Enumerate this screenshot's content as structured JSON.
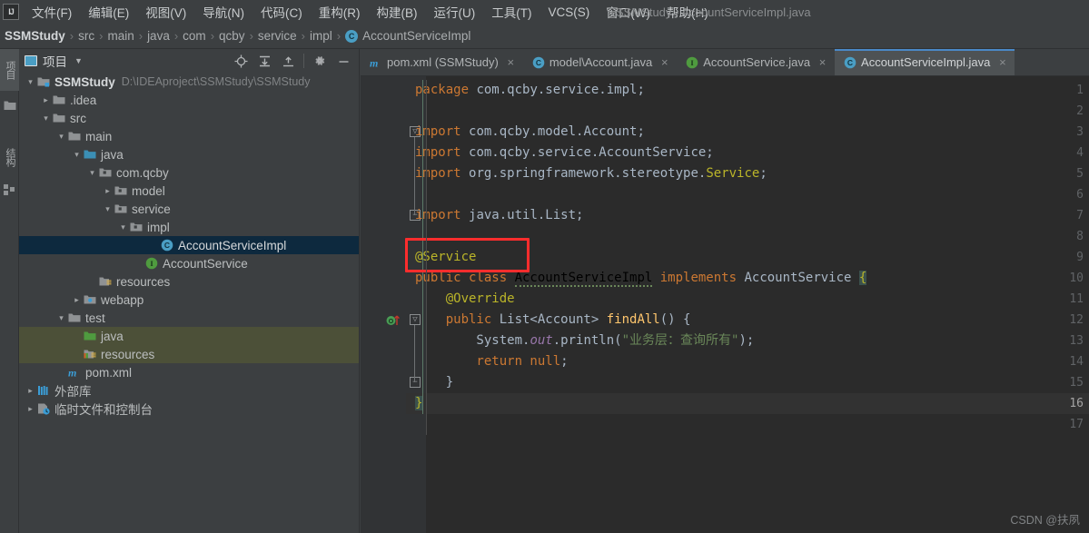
{
  "window": {
    "title": "SSMStudy - AccountServiceImpl.java",
    "logo": "IJ"
  },
  "menubar": {
    "items": [
      {
        "label": "文件(F)",
        "name": "menu-file"
      },
      {
        "label": "编辑(E)",
        "name": "menu-edit"
      },
      {
        "label": "视图(V)",
        "name": "menu-view"
      },
      {
        "label": "导航(N)",
        "name": "menu-navigate"
      },
      {
        "label": "代码(C)",
        "name": "menu-code"
      },
      {
        "label": "重构(R)",
        "name": "menu-refactor"
      },
      {
        "label": "构建(B)",
        "name": "menu-build"
      },
      {
        "label": "运行(U)",
        "name": "menu-run"
      },
      {
        "label": "工具(T)",
        "name": "menu-tools"
      },
      {
        "label": "VCS(S)",
        "name": "menu-vcs"
      },
      {
        "label": "窗口(W)",
        "name": "menu-window"
      },
      {
        "label": "帮助(H)",
        "name": "menu-help"
      }
    ]
  },
  "breadcrumb": {
    "separator": "›",
    "items": [
      "SSMStudy",
      "src",
      "main",
      "java",
      "com",
      "qcby",
      "service",
      "impl"
    ],
    "leaf": "AccountServiceImpl",
    "leaf_icon_letter": "C"
  },
  "toolstrip": {
    "buttons": [
      {
        "label": "项目",
        "name": "tool-button-project",
        "type": "vertical-text"
      },
      {
        "label": "",
        "name": "tool-button-folder",
        "type": "icon"
      },
      {
        "label": "结构",
        "name": "tool-button-structure",
        "type": "vertical-text"
      },
      {
        "label": "",
        "name": "tool-button-bookmarks",
        "type": "icon"
      }
    ]
  },
  "project_panel": {
    "title": "项目",
    "tools": [
      {
        "name": "locate-icon",
        "title": "Select Opened File"
      },
      {
        "name": "expand-all-icon",
        "title": "Expand All"
      },
      {
        "name": "collapse-all-icon",
        "title": "Collapse All"
      },
      {
        "name": "gear-icon",
        "title": "Settings"
      },
      {
        "name": "minimize-icon",
        "title": "Hide"
      }
    ],
    "tree": [
      {
        "label": "SSMStudy",
        "path": "D:\\IDEAproject\\SSMStudy\\SSMStudy",
        "indent": 0,
        "arrow": "down",
        "icon": "module-folder",
        "bold": true,
        "state": "normal"
      },
      {
        "label": ".idea",
        "path": "",
        "indent": 1,
        "arrow": "right",
        "icon": "folder",
        "bold": false,
        "state": "normal"
      },
      {
        "label": "src",
        "path": "",
        "indent": 1,
        "arrow": "down",
        "icon": "folder",
        "bold": false,
        "state": "normal"
      },
      {
        "label": "main",
        "path": "",
        "indent": 2,
        "arrow": "down",
        "icon": "folder",
        "bold": false,
        "state": "normal"
      },
      {
        "label": "java",
        "path": "",
        "indent": 3,
        "arrow": "down",
        "icon": "source-folder",
        "bold": false,
        "state": "normal"
      },
      {
        "label": "com.qcby",
        "path": "",
        "indent": 4,
        "arrow": "down",
        "icon": "package",
        "bold": false,
        "state": "normal"
      },
      {
        "label": "model",
        "path": "",
        "indent": 5,
        "arrow": "right",
        "icon": "package",
        "bold": false,
        "state": "normal"
      },
      {
        "label": "service",
        "path": "",
        "indent": 5,
        "arrow": "down",
        "icon": "package",
        "bold": false,
        "state": "normal"
      },
      {
        "label": "impl",
        "path": "",
        "indent": 6,
        "arrow": "down",
        "icon": "package",
        "bold": false,
        "state": "normal"
      },
      {
        "label": "AccountServiceImpl",
        "path": "",
        "indent": 8,
        "arrow": "none",
        "icon": "class",
        "bold": false,
        "state": "selected"
      },
      {
        "label": "AccountService",
        "path": "",
        "indent": 7,
        "arrow": "none",
        "icon": "interface",
        "bold": false,
        "state": "normal"
      },
      {
        "label": "resources",
        "path": "",
        "indent": 4,
        "arrow": "none",
        "icon": "resources-folder",
        "bold": false,
        "state": "normal"
      },
      {
        "label": "webapp",
        "path": "",
        "indent": 3,
        "arrow": "right",
        "icon": "webapp-folder",
        "bold": false,
        "state": "normal"
      },
      {
        "label": "test",
        "path": "",
        "indent": 2,
        "arrow": "down",
        "icon": "folder",
        "bold": false,
        "state": "normal"
      },
      {
        "label": "java",
        "path": "",
        "indent": 3,
        "arrow": "none",
        "icon": "test-source-folder",
        "bold": false,
        "state": "test-highlight"
      },
      {
        "label": "resources",
        "path": "",
        "indent": 3,
        "arrow": "none",
        "icon": "test-resources-folder",
        "bold": false,
        "state": "test-highlight"
      },
      {
        "label": "pom.xml",
        "path": "",
        "indent": 2,
        "arrow": "none",
        "icon": "maven",
        "bold": false,
        "state": "normal"
      },
      {
        "label": "外部库",
        "path": "",
        "indent": 0,
        "arrow": "right",
        "icon": "library",
        "bold": false,
        "state": "normal"
      },
      {
        "label": "临时文件和控制台",
        "path": "",
        "indent": 0,
        "arrow": "right",
        "icon": "scratches",
        "bold": false,
        "state": "normal"
      }
    ]
  },
  "editor_tabs": [
    {
      "label": "pom.xml (SSMStudy)",
      "icon": "maven-icon",
      "active": false,
      "close": "×"
    },
    {
      "label": "model\\Account.java",
      "icon": "class-icon",
      "active": false,
      "close": "×"
    },
    {
      "label": "AccountService.java",
      "icon": "interface-icon",
      "active": false,
      "close": "×"
    },
    {
      "label": "AccountServiceImpl.java",
      "icon": "class-icon",
      "active": true,
      "close": "×"
    }
  ],
  "editor": {
    "current_line": 16,
    "line_count": 17,
    "lines": [
      {
        "n": 1,
        "tokens": [
          {
            "t": "package ",
            "c": "kw"
          },
          {
            "t": "com.qcby.service.impl;",
            "c": "pl"
          }
        ]
      },
      {
        "n": 2,
        "tokens": []
      },
      {
        "n": 3,
        "tokens": [
          {
            "t": "import ",
            "c": "kw"
          },
          {
            "t": "com.qcby.model.Account;",
            "c": "pl"
          }
        ]
      },
      {
        "n": 4,
        "tokens": [
          {
            "t": "import ",
            "c": "kw"
          },
          {
            "t": "com.qcby.service.AccountService;",
            "c": "pl"
          }
        ]
      },
      {
        "n": 5,
        "tokens": [
          {
            "t": "import ",
            "c": "kw"
          },
          {
            "t": "org.springframework.stereotype.",
            "c": "pl"
          },
          {
            "t": "Service",
            "c": "ann"
          },
          {
            "t": ";",
            "c": "pl"
          }
        ]
      },
      {
        "n": 6,
        "tokens": []
      },
      {
        "n": 7,
        "tokens": [
          {
            "t": "import ",
            "c": "kw"
          },
          {
            "t": "java.util.List;",
            "c": "pl"
          }
        ]
      },
      {
        "n": 8,
        "tokens": []
      },
      {
        "n": 9,
        "tokens": [
          {
            "t": "@Service",
            "c": "ann"
          }
        ]
      },
      {
        "n": 10,
        "tokens": [
          {
            "t": "public class ",
            "c": "kw"
          },
          {
            "t": "AccountServiceImpl",
            "c": "warnu"
          },
          {
            "t": " ",
            "c": "pl"
          },
          {
            "t": "implements",
            "c": "kw"
          },
          {
            "t": " AccountService ",
            "c": "pl"
          },
          {
            "t": "{",
            "c": "brcg"
          }
        ]
      },
      {
        "n": 11,
        "tokens": [
          {
            "t": "    @Override",
            "c": "ann"
          }
        ]
      },
      {
        "n": 12,
        "tokens": [
          {
            "t": "    public ",
            "c": "kw"
          },
          {
            "t": "List<Account> ",
            "c": "pl"
          },
          {
            "t": "findAll",
            "c": "mth"
          },
          {
            "t": "() {",
            "c": "pl"
          }
        ]
      },
      {
        "n": 13,
        "tokens": [
          {
            "t": "        System.",
            "c": "pl"
          },
          {
            "t": "out",
            "c": "fld"
          },
          {
            "t": ".println(",
            "c": "pl"
          },
          {
            "t": "\"业务层：查询所有\"",
            "c": "str"
          },
          {
            "t": ");",
            "c": "pl"
          }
        ]
      },
      {
        "n": 14,
        "tokens": [
          {
            "t": "        return null",
            "c": "kw"
          },
          {
            "t": ";",
            "c": "pl"
          }
        ]
      },
      {
        "n": 15,
        "tokens": [
          {
            "t": "    }",
            "c": "pl"
          }
        ]
      },
      {
        "n": 16,
        "tokens": [
          {
            "t": "}",
            "c": "brcg"
          }
        ]
      },
      {
        "n": 17,
        "tokens": []
      }
    ],
    "gutter_icons": [
      {
        "line": 12,
        "name": "implementing-method-icon",
        "glyph": "O"
      }
    ],
    "fold_marks": [
      {
        "line": 3,
        "glyph": "▽"
      },
      {
        "line": 7,
        "glyph": "−"
      },
      {
        "line": 12,
        "glyph": "▽"
      },
      {
        "line": 15,
        "glyph": "−"
      }
    ]
  },
  "annotation": {
    "name": "red-highlight-box",
    "color": "#ff2d2d",
    "targets": "@Service"
  },
  "watermark": {
    "text": "CSDN @扶夙"
  },
  "colors": {
    "chrome": "#3c3f41",
    "editor_bg": "#2b2b2b",
    "gutter_bg": "#313335",
    "selection": "#0d293e",
    "test_highlight": "#4c5038",
    "accent_blue": "#4a9ec4",
    "keyword": "#cc7832",
    "string": "#6a8759",
    "annotation": "#bbb529",
    "method": "#ffc66d",
    "field": "#9876aa"
  }
}
